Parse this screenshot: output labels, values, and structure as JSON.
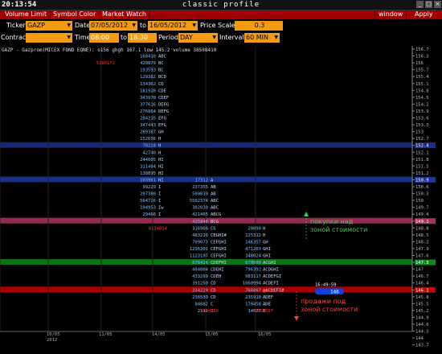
{
  "window": {
    "clock": "20:13:54",
    "title": "classic profile"
  },
  "menu": {
    "items": [
      "Volume Limit",
      "Symbol Color",
      "Market Watch"
    ],
    "right_items": [
      "window",
      "Apply"
    ]
  },
  "toolbar": {
    "ticker_label": "Ticker",
    "ticker_value": "GAZP",
    "date_label": "Date",
    "date_from": "07/05/2012",
    "to_label": "to",
    "date_to": "16/05/2012",
    "price_scale_label": "Price Scale",
    "price_scale_value": "0.3",
    "contract_label": "Contract",
    "time_label": "Time",
    "time_from": "08:00",
    "time_to_label": "to",
    "time_to": "18:30",
    "period_label": "Period",
    "period_value": "DAY",
    "interval_label": "Interval",
    "interval_value": "60 MIN"
  },
  "chart": {
    "header": "GAZP - Gazprom(MICEX FOND EQNE):  o156  ghgh 167.1  low 145.2 volume 38508410",
    "annotation_above": "покупки над\nзоной стоимости",
    "annotation_below": "продажи под\nзоной стоимости",
    "current_time_tag": "16:49:59",
    "current_price_box": "146",
    "red_numbers": [
      "5280172",
      "6134054",
      "3084080",
      "4054597"
    ],
    "price_ticks": [
      "156.7",
      "156.3",
      "156",
      "155.7",
      "155.4",
      "155.1",
      "154.8",
      "154.5",
      "154.2",
      "153.9",
      "153.6",
      "153.3",
      "153",
      "152.7",
      "152.4",
      "152.1",
      "151.8",
      "151.5",
      "151.2",
      "150.9",
      "150.6",
      "150.3",
      "150",
      "149.7",
      "149.4",
      "149.1",
      "148.8",
      "148.5",
      "148.2",
      "147.9",
      "147.6",
      "147.3",
      "147",
      "146.7",
      "146.4",
      "146.1",
      "145.8",
      "145.5",
      "145.2",
      "144.9",
      "144.6",
      "144.3",
      "144",
      "143.7"
    ],
    "x_labels": [
      "10/05\n2012",
      "11/05",
      "14/05",
      "15/05",
      "16/05"
    ],
    "col1": [
      [
        "168410",
        "ABC"
      ],
      [
        "420879",
        "BC"
      ],
      [
        "193593",
        "BC"
      ],
      [
        "129382",
        "BCD"
      ],
      [
        "134362",
        "CD"
      ],
      [
        "181920",
        "CDE"
      ],
      [
        "343978",
        "CDEF"
      ],
      [
        "377616",
        "DEFG"
      ],
      [
        "276864",
        "DEFG"
      ],
      [
        "284235",
        "EFG"
      ],
      [
        "347443",
        "EFG"
      ],
      [
        "289387",
        "GH"
      ],
      [
        "152656",
        "H"
      ],
      [
        "78228",
        "H"
      ],
      [
        "42740",
        "H"
      ],
      [
        "244605",
        "HI"
      ],
      [
        "311404",
        "HI"
      ],
      [
        "138895",
        "HI"
      ],
      [
        "103981",
        "HI"
      ],
      [
        "99229",
        "I"
      ],
      [
        "297380",
        "I"
      ],
      [
        "564726",
        "I"
      ],
      [
        "194953",
        "Iw"
      ],
      [
        "29466",
        "I"
      ]
    ],
    "col2": [
      [
        "17312",
        "A"
      ],
      [
        "237355",
        "AB"
      ],
      [
        "500039",
        "AB"
      ],
      [
        "5502374",
        "ABC"
      ],
      [
        "302039",
        "ABC"
      ],
      [
        "421465",
        "ABCG"
      ],
      [
        "425846",
        "BCG"
      ],
      [
        "316966",
        "CG"
      ],
      [
        "483226",
        "CEGHI#"
      ],
      [
        "709073",
        "CEFGHI"
      ],
      [
        "1236301",
        "CEFGHI"
      ],
      [
        "1123197",
        "CEFGHI"
      ],
      [
        "678426",
        "CDEFHI"
      ],
      [
        "484804",
        "CDEHI"
      ],
      [
        "433269",
        "CDEH"
      ],
      [
        "391250",
        "CD"
      ],
      [
        "334220",
        "CD"
      ],
      [
        "236539",
        "CD"
      ],
      [
        "84082",
        "C"
      ],
      [
        "2112",
        "C"
      ]
    ],
    "col3": [
      [
        "20090",
        "H"
      ],
      [
        "125312",
        "H"
      ],
      [
        "146357",
        "GH"
      ],
      [
        "471203",
        "GHI"
      ],
      [
        "348024",
        "GHI"
      ],
      [
        "670000",
        "ACGHI"
      ],
      [
        "796392",
        "ACDGHI"
      ],
      [
        "983117",
        "ACDEFGI"
      ],
      [
        "1060994",
        "ACDEFI"
      ],
      [
        "766867",
        "@ACDEFI#"
      ],
      [
        "235910",
        "ADEF"
      ],
      [
        "170458",
        "ADE"
      ],
      [
        "14677",
        "D"
      ]
    ]
  }
}
